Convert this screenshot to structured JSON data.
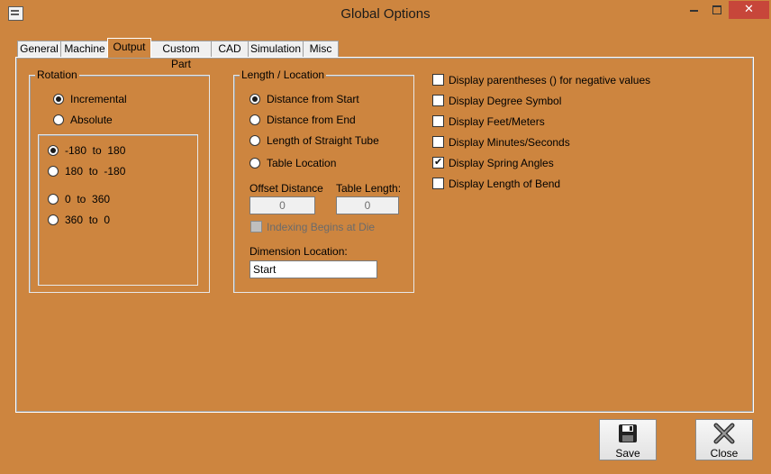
{
  "window": {
    "title": "Global Options",
    "close_glyph": "✕"
  },
  "tabs": [
    "General",
    "Machine",
    "Output",
    "Custom Part",
    "CAD",
    "Simulation",
    "Misc"
  ],
  "active_tab": "Output",
  "rotation": {
    "legend": "Rotation",
    "mode_options": [
      {
        "label": "Incremental",
        "selected": true
      },
      {
        "label": "Absolute",
        "selected": false
      }
    ],
    "range_options": [
      {
        "label": "-180  to  180",
        "selected": true
      },
      {
        "label": "180  to  -180",
        "selected": false
      },
      {
        "label": "0  to  360",
        "selected": false
      },
      {
        "label": "360  to  0",
        "selected": false
      }
    ]
  },
  "length_location": {
    "legend": "Length / Location",
    "options": [
      {
        "label": "Distance from Start",
        "selected": true
      },
      {
        "label": "Distance from End",
        "selected": false
      },
      {
        "label": "Length of Straight Tube",
        "selected": false
      },
      {
        "label": "Table Location",
        "selected": false
      }
    ],
    "offset_distance_label": "Offset Distance",
    "offset_distance_value": "0",
    "table_length_label": "Table Length:",
    "table_length_value": "0",
    "indexing_label": "Indexing Begins at Die",
    "dimension_location_label": "Dimension Location:",
    "dimension_location_value": "Start"
  },
  "display_options": [
    {
      "label": "Display parentheses () for negative values",
      "checked": false
    },
    {
      "label": "Display Degree Symbol",
      "checked": false
    },
    {
      "label": "Display Feet/Meters",
      "checked": false
    },
    {
      "label": "Display Minutes/Seconds",
      "checked": false
    },
    {
      "label": "Display Spring Angles",
      "checked": true
    },
    {
      "label": "Display Length of Bend",
      "checked": false
    }
  ],
  "buttons": {
    "save": "Save",
    "close": "Close"
  },
  "colors": {
    "background": "#cd853f",
    "close_button": "#c7463a"
  }
}
